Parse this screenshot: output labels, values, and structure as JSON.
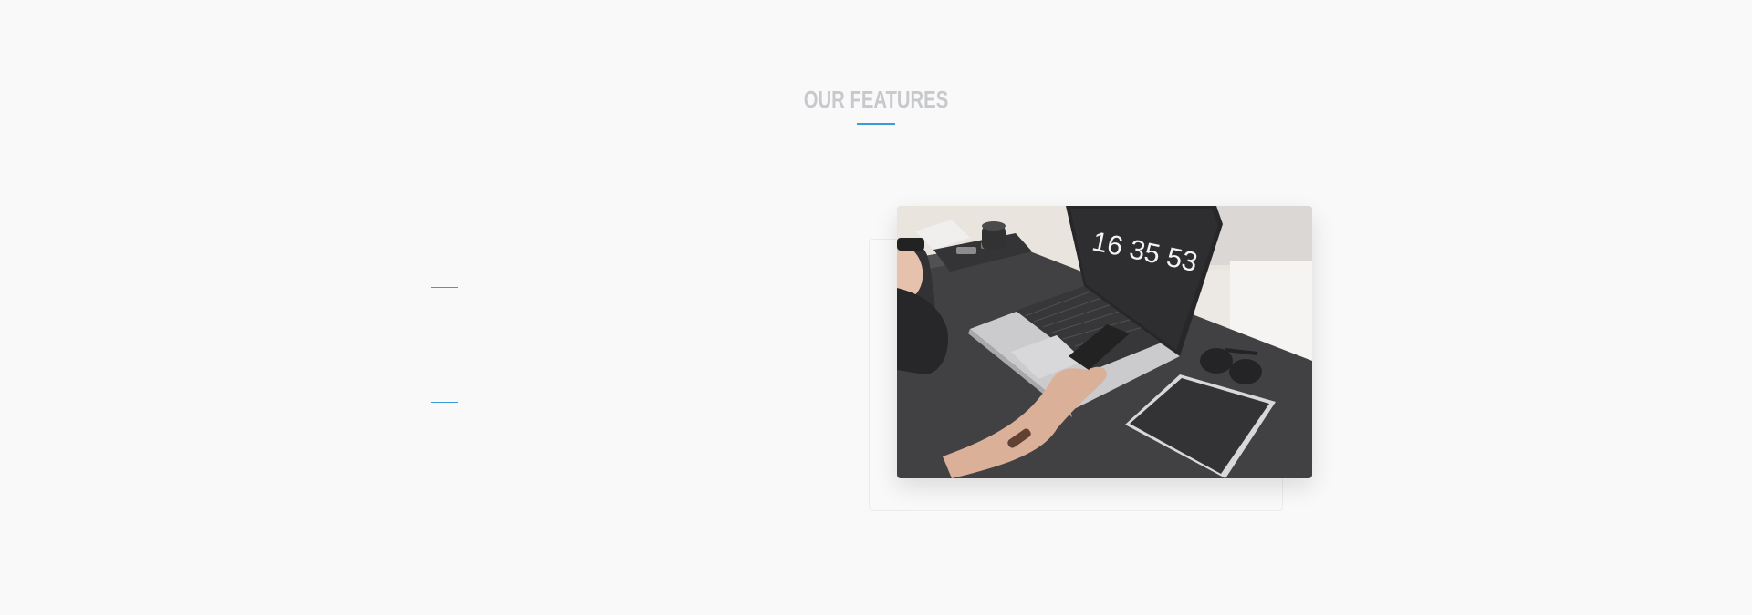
{
  "section": {
    "title": "OUR FEATURES",
    "accent_color": "#3d9ad6",
    "title_color": "#c7c9cc"
  },
  "photo": {
    "subject": "laptop-phone-tablet-desk-photo",
    "clock_text": "16 35 53"
  }
}
